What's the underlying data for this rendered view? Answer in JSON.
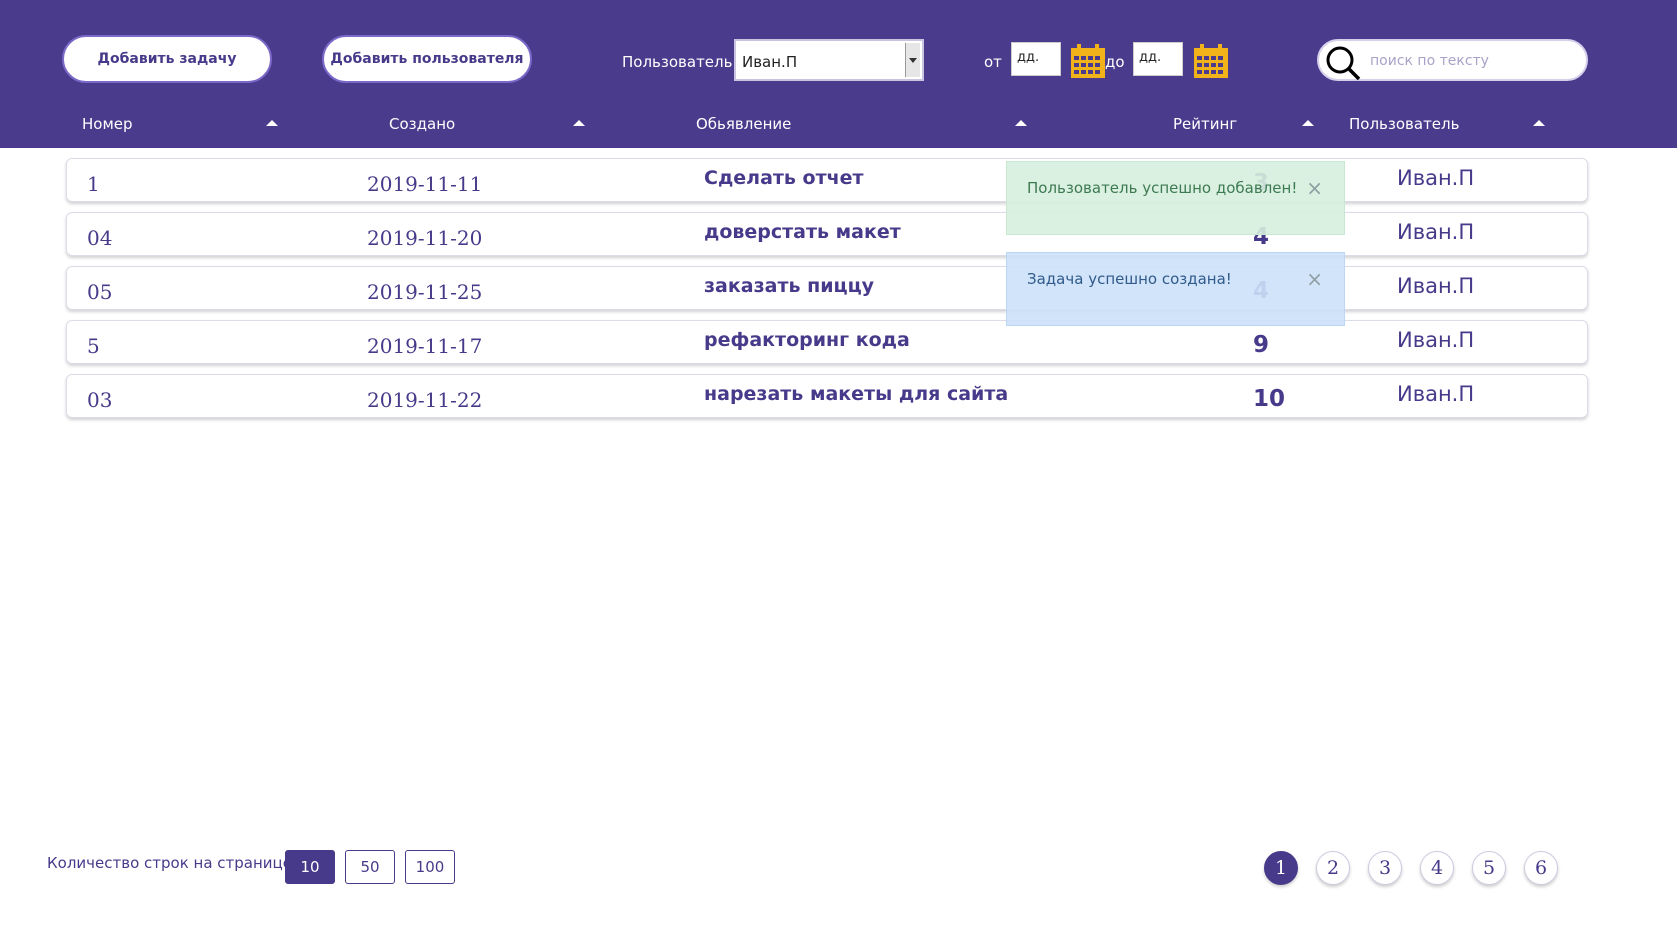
{
  "toolbar": {
    "add_task_label": "Добавить задачу",
    "add_user_label": "Добавить пользователя",
    "user_label": "Пользователь",
    "user_value": "Иван.П",
    "from_label": "от",
    "to_label": "до",
    "date_from_placeholder": "дд.",
    "date_to_placeholder": "дд.",
    "search_placeholder": "поиск по тексту"
  },
  "columns": [
    "Номер",
    "Создано",
    "Обьявление",
    "Рейтинг",
    "Пользователь"
  ],
  "rows": [
    {
      "num": "1",
      "created": "2019-11-11",
      "title": "Сделать отчет",
      "rating": "3",
      "user": "Иван.П"
    },
    {
      "num": "04",
      "created": "2019-11-20",
      "title": "доверстать макет",
      "rating": "4",
      "user": "Иван.П"
    },
    {
      "num": "05",
      "created": "2019-11-25",
      "title": "заказать пиццу",
      "rating": "4",
      "user": "Иван.П"
    },
    {
      "num": "5",
      "created": "2019-11-17",
      "title": "рефакторинг кода",
      "rating": "9",
      "user": "Иван.П"
    },
    {
      "num": "03",
      "created": "2019-11-22",
      "title": "нарезать макеты для сайта",
      "rating": "10",
      "user": "Иван.П"
    }
  ],
  "toasts": [
    {
      "text": "Пользователь успешно добавлен!",
      "close": "×"
    },
    {
      "text": "Задача успешно создана!",
      "close": "×"
    }
  ],
  "footer": {
    "rows_label": "Количество строк на странице:",
    "page_sizes": [
      "10",
      "50",
      "100"
    ],
    "active_page_size": "10",
    "pages": [
      "1",
      "2",
      "3",
      "4",
      "5",
      "6"
    ],
    "active_page": "1"
  },
  "colors": {
    "header_bg": "#4a3b8c",
    "accent": "#473a8a",
    "calendar_icon": "#f2b31a",
    "toast_success": "#d6f0de",
    "toast_info": "#cde1fa"
  }
}
